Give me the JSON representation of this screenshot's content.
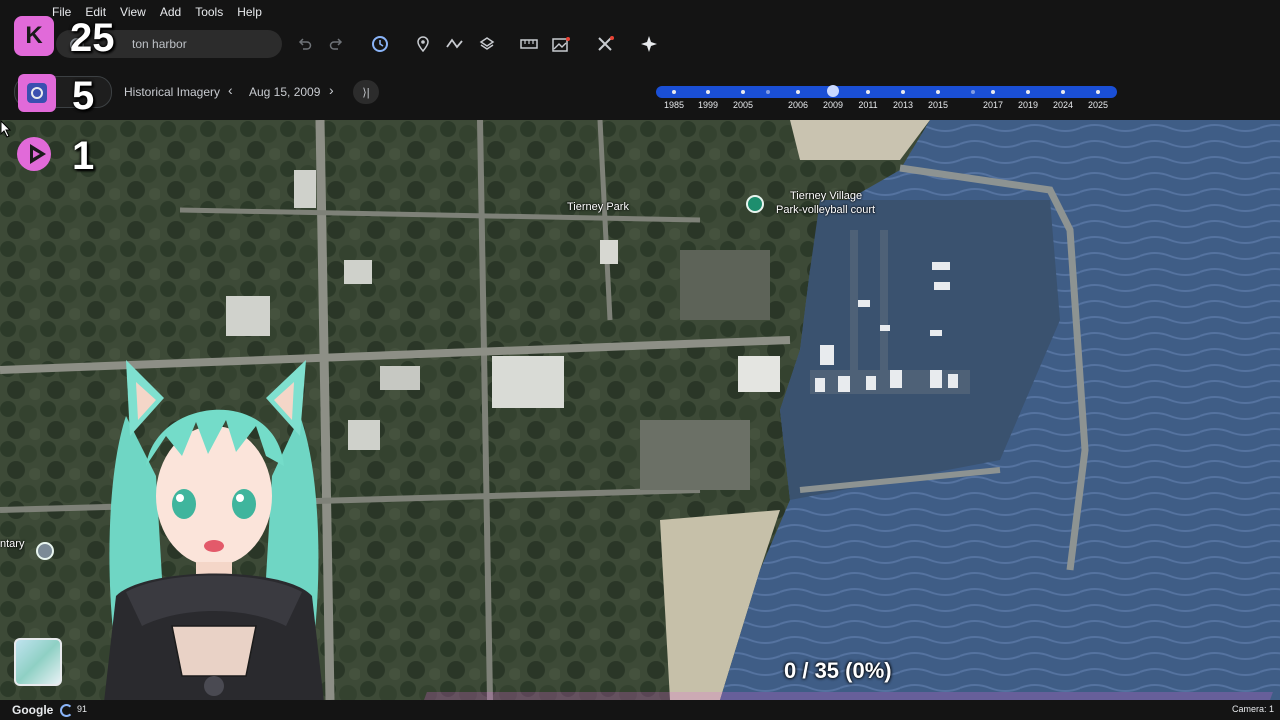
{
  "menu": [
    "File",
    "Edit",
    "View",
    "Add",
    "Tools",
    "Help"
  ],
  "search": {
    "value": "ton harbor"
  },
  "toolbar_icons": [
    "undo-icon",
    "redo-icon",
    "historical-imagery-icon",
    "placemark-icon",
    "path-icon",
    "layers-icon",
    "ruler-icon",
    "image-overlay-icon",
    "settings-tools-icon",
    "sparkle-icon"
  ],
  "history": {
    "label": "Historical Imagery",
    "date": "Aug 15, 2009",
    "prev_symbol": "‹",
    "next_symbol": "›",
    "end_symbol": "⟩|",
    "years": [
      "1985",
      "1999",
      "2005",
      "2006",
      "2009",
      "2011",
      "2013",
      "2015",
      "2017",
      "2019",
      "2024",
      "2025"
    ],
    "selected_year": "2009"
  },
  "map": {
    "labels": {
      "park": "Tierney Park",
      "village_line1": "Tierney Village",
      "village_line2": "Park-volleyball court",
      "left_edge": "ntary"
    }
  },
  "overlay": {
    "counter_a": "25",
    "counter_b": "5",
    "counter_c": "1",
    "progress_text": "0 / 35 (0%)",
    "progress_fraction": 0.0,
    "accent": "#d760d2"
  },
  "status": {
    "google": "Google",
    "loading": "91",
    "camera": "Camera: 1"
  },
  "colors": {
    "water": "#3f5d86",
    "timeline": "#1a4fd6",
    "toolbar": "#141414"
  }
}
